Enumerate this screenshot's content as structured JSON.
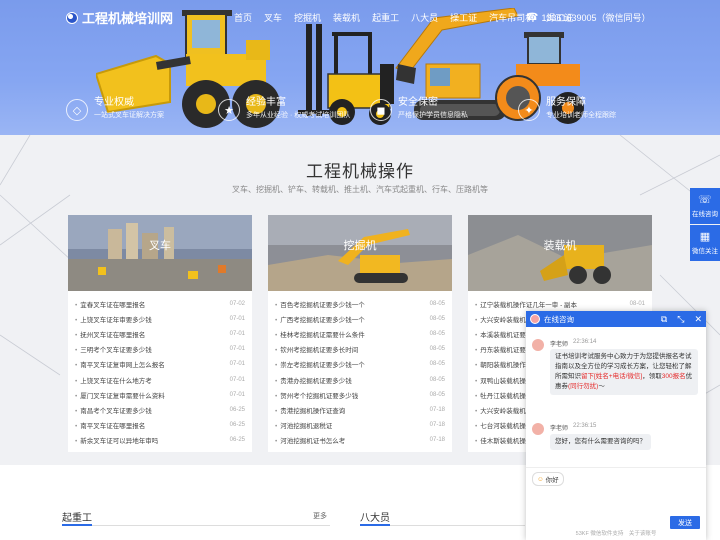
{
  "header": {
    "logo_text": "工程机械培训网",
    "nav": [
      "首页",
      "叉车",
      "挖掘机",
      "装载机",
      "起重工",
      "八大员",
      "操工证",
      "汽车吊司机",
      "焊工证"
    ],
    "phone": "13361639005（微信同号）"
  },
  "features": [
    {
      "title": "专业权威",
      "sub": "一站式叉车证解决方案",
      "icon": "shield-icon"
    },
    {
      "title": "经验丰富",
      "sub": "多年从业经验 · 权威考试培训团队",
      "icon": "badge-icon"
    },
    {
      "title": "安全保密",
      "sub": "严格保护学员信息隐私",
      "icon": "lock-icon"
    },
    {
      "title": "服务保障",
      "sub": "专业培训老师全程跟踪",
      "icon": "service-icon"
    }
  ],
  "section": {
    "title": "工程机械操作",
    "subtitle": "叉车、挖掘机、铲车、转载机、推土机、汽车式起重机、行车、压路机等"
  },
  "cards": [
    {
      "title": "叉车",
      "items": [
        {
          "t": "宜春叉车证在哪里报名",
          "d": "07-02"
        },
        {
          "t": "上饶叉车证年审要多少钱",
          "d": "07-01"
        },
        {
          "t": "抚州叉车证在哪里报名",
          "d": "07-01"
        },
        {
          "t": "三明考个叉车证要多少钱",
          "d": "07-01"
        },
        {
          "t": "南平叉车证复审网上怎么报名",
          "d": "07-01"
        },
        {
          "t": "上饶叉车证在什么地方考",
          "d": "07-01"
        },
        {
          "t": "厦门叉车证复审需要什么资料",
          "d": "07-01"
        },
        {
          "t": "南昌考个叉车证要多少钱",
          "d": "06-25"
        },
        {
          "t": "南平叉车证在哪里报名",
          "d": "06-25"
        },
        {
          "t": "新余叉车证可以异地年审吗",
          "d": "06-25"
        }
      ]
    },
    {
      "title": "挖掘机",
      "items": [
        {
          "t": "百色考挖掘机证要多少钱一个",
          "d": "08-05"
        },
        {
          "t": "广西考挖掘机证要多少钱一个",
          "d": "08-05"
        },
        {
          "t": "桂林考挖掘机证需要什么条件",
          "d": "08-05"
        },
        {
          "t": "钦州考挖掘机证要多长时间",
          "d": "08-05"
        },
        {
          "t": "崇左考挖掘机证要多少钱一个",
          "d": "08-05"
        },
        {
          "t": "贵港办挖掘机证要多少钱",
          "d": "08-05"
        },
        {
          "t": "贺州考个挖掘机证要多少钱",
          "d": "08-05"
        },
        {
          "t": "贵港挖掘机操作证查询",
          "d": "07-18"
        },
        {
          "t": "河池挖掘机退税证",
          "d": "07-18"
        },
        {
          "t": "河池挖掘机证书怎么考",
          "d": "07-18"
        }
      ]
    },
    {
      "title": "装载机",
      "items": [
        {
          "t": "辽宁装载机操作证几年一审 - 副本",
          "d": "08-01"
        },
        {
          "t": "大兴安岭装载机",
          "d": ""
        },
        {
          "t": "本溪装载机证要",
          "d": ""
        },
        {
          "t": "丹东装载机证要",
          "d": ""
        },
        {
          "t": "朝阳装载机操作",
          "d": ""
        },
        {
          "t": "双鸭山装载机操",
          "d": ""
        },
        {
          "t": "牡丹江装载机操",
          "d": ""
        },
        {
          "t": "大兴安岭装载机",
          "d": ""
        },
        {
          "t": "七台河装载机操",
          "d": ""
        },
        {
          "t": "佳木斯装载机操",
          "d": ""
        }
      ]
    }
  ],
  "bottom": {
    "tab1": "起重工",
    "more": "更多",
    "tab2": "八大员"
  },
  "float": {
    "consult": "在线咨询",
    "wechat": "微信关注"
  },
  "chat": {
    "title": "在线咨询",
    "messages": [
      {
        "name": "李老师",
        "time": "22:36:14",
        "text1": "证书培训考试服务中心致力于为您提供报名考试指南以及全方位的学习成长方案，让您轻松了解所需知识",
        "red1": "留下[姓名+电话/微信]",
        "text2": "，领取",
        "red2": "300报名",
        "text3": "优惠券",
        "red3": "(同行勿扰)",
        "text4": "～"
      },
      {
        "name": "李老师",
        "time": "22:36:15",
        "text1": "您好，您有什么需要咨询的吗？"
      }
    ],
    "emoji_label": "你好",
    "send_label": "发送",
    "footer": "53KF 微信软件支持　关于该账号"
  },
  "colors": {
    "brand": "#2b6be6",
    "banner": "#86a6f2",
    "red": "#e52a2a"
  }
}
